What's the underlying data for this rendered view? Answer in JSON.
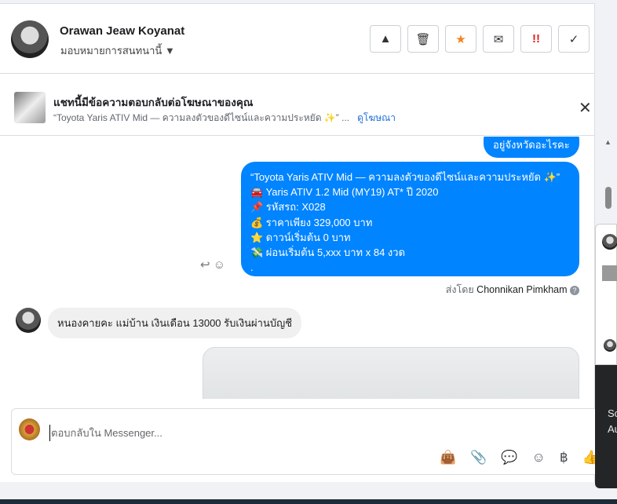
{
  "header": {
    "name": "Orawan Jeaw Koyanat",
    "assign": "มอบหมายการสนทนานี้",
    "buttons": [
      "warning-icon",
      "trash-icon",
      "star-icon",
      "envelope-icon",
      "urgent-icon",
      "check-icon"
    ],
    "button_glyphs": [
      "▲",
      "🗑",
      "★",
      "✉",
      "!!",
      "✓"
    ]
  },
  "banner": {
    "title": "แชทนี้มีข้อความตอบกลับต่อโฆษณาของคุณ",
    "subtitle": "“Toyota Yaris ATIV Mid — ความลงตัวของดีไซน์และความประหยัด ✨” ...",
    "link": "ดูโฆษณา",
    "close": "✕"
  },
  "messages": {
    "m1": "อยู่จังหวัดอะไรคะ",
    "m2": [
      "“Toyota Yaris ATIV Mid — ความลงตัวของดีไซน์และความประหยัด ✨”",
      "🚘 Yaris ATIV 1.2 Mid (MY19) AT*  ปี 2020",
      "📌 รหัสรถ: X028",
      "💰 ราคาเพียง 329,000 บาท",
      "⭐ ดาวน์เริ่มต้น 0 บาท",
      "💸 ผ่อนเริ่มต้น 5,xxx บาท x 84 งวด",
      "."
    ],
    "sent_by_prefix": "ส่งโดย",
    "sent_by_name": "Chonnikan Pimkham",
    "m3": "หนองคายคะ แม่บ้าน เงินเดือน 13000 รับเงินผ่านบัญชี"
  },
  "composer": {
    "placeholder": "ตอบกลับใน Messenger...",
    "baht": "฿"
  },
  "toast": {
    "line1": "Sc",
    "line2": "Au"
  },
  "colors": {
    "accent": "#0084ff",
    "star": "#f5821f",
    "urgent": "#e02020"
  }
}
